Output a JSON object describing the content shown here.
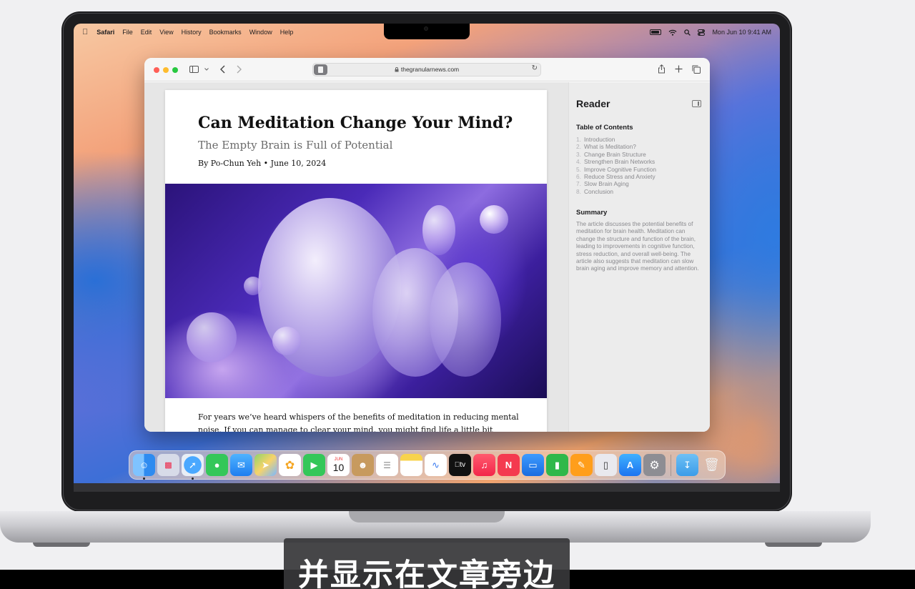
{
  "menubar": {
    "app": "Safari",
    "items": [
      "File",
      "Edit",
      "View",
      "History",
      "Bookmarks",
      "Window",
      "Help"
    ],
    "clock": "Mon Jun 10  9:41 AM"
  },
  "safari": {
    "url": "thegranularnews.com"
  },
  "article": {
    "title": "Can Meditation Change Your Mind?",
    "subtitle": "The Empty Brain is Full of Potential",
    "byline": "By Po-Chun Yeh  •  June 10, 2024",
    "body": "For years we’ve heard whispers of the benefits of meditation in reducing mental noise. If you can manage to clear your mind, you might find life a little bit lighter."
  },
  "reader": {
    "title": "Reader",
    "toc_heading": "Table of Contents",
    "toc": [
      {
        "num": "1.",
        "label": "Introduction"
      },
      {
        "num": "2.",
        "label": "What is Meditation?"
      },
      {
        "num": "3.",
        "label": "Change Brain Structure"
      },
      {
        "num": "4.",
        "label": "Strengthen Brain Networks"
      },
      {
        "num": "5.",
        "label": "Improve Cognitive Function"
      },
      {
        "num": "6.",
        "label": "Reduce Stress and Anxiety"
      },
      {
        "num": "7.",
        "label": "Slow Brain Aging"
      },
      {
        "num": "8.",
        "label": "Conclusion"
      }
    ],
    "summary_heading": "Summary",
    "summary": "The article discusses the potential benefits of meditation for brain health. Meditation can change the structure and function of the brain, leading to improvements in cognitive function, stress reduction, and overall well-being. The article also suggests that meditation can slow brain aging and improve memory and attention."
  },
  "dock": {
    "calendar_month": "JUN",
    "calendar_day": "10",
    "tv_label": "tv"
  },
  "caption": "并显示在文章旁边"
}
